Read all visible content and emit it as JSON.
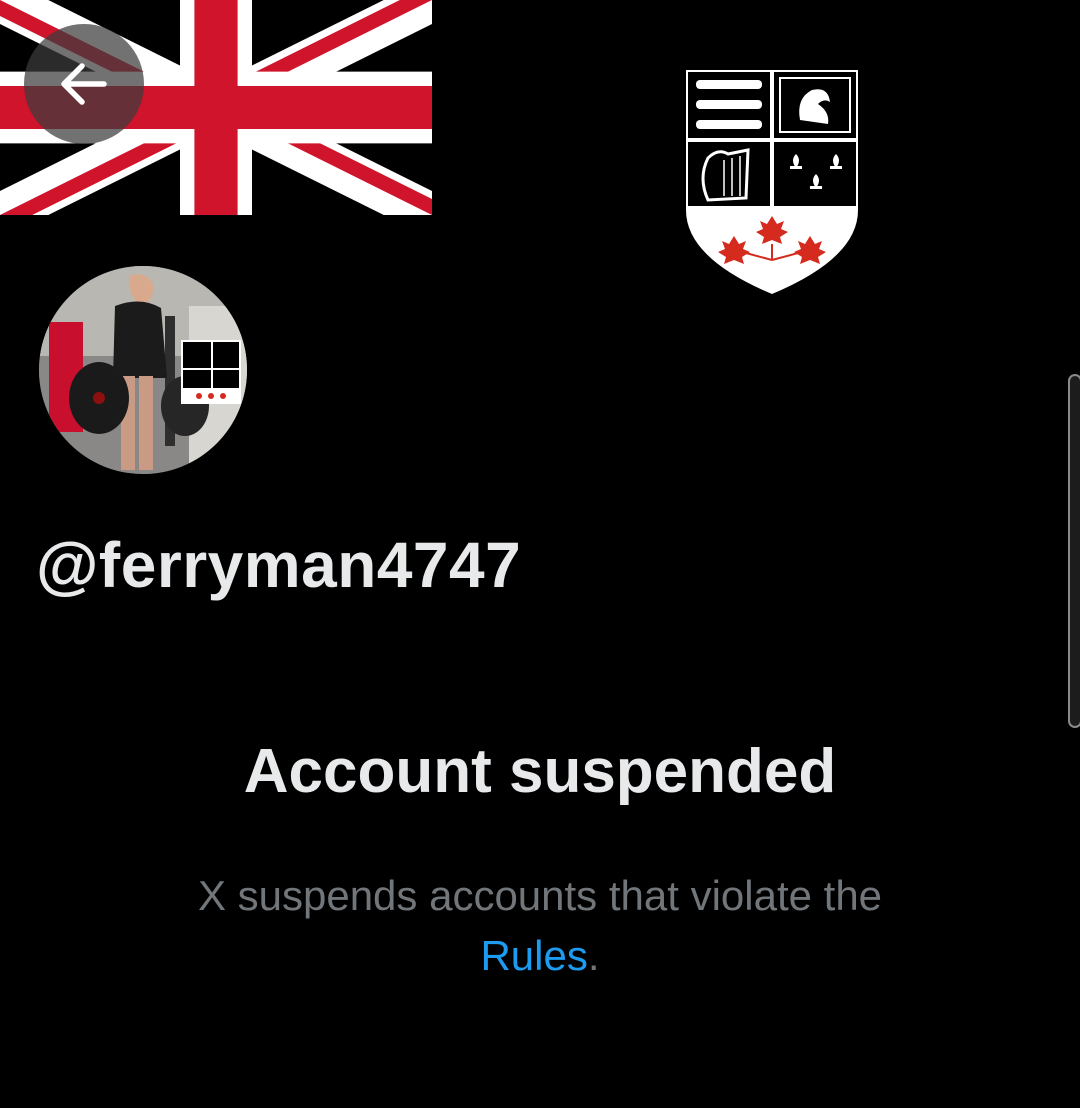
{
  "profile": {
    "handle": "@ferryman4747",
    "back_icon": "arrow-left-icon"
  },
  "suspension": {
    "title": "Account suspended",
    "description": "X suspends accounts that violate the",
    "rules_link": "Rules",
    "period": "."
  },
  "colors": {
    "background": "#000000",
    "primary_text": "#e7e9ea",
    "secondary_text": "#71767b",
    "link": "#1d9bf0",
    "flag_red": "#cf142b",
    "flag_white": "#ffffff",
    "maple_red": "#d52b1e"
  }
}
